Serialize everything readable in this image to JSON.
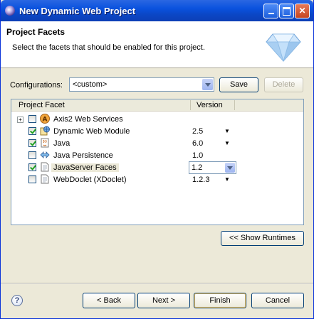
{
  "window": {
    "title": "New Dynamic Web Project"
  },
  "header": {
    "title": "Project Facets",
    "description": "Select the facets that should be enabled for this project."
  },
  "configurations": {
    "label": "Configurations:",
    "value": "<custom>",
    "save_label": "Save",
    "delete_label": "Delete"
  },
  "table": {
    "columns": [
      "Project Facet",
      "Version"
    ],
    "rows": [
      {
        "name": "Axis2 Web Services",
        "version": "",
        "checked": false,
        "expandable": true,
        "icon": "axis2-icon"
      },
      {
        "name": "Dynamic Web Module",
        "version": "2.5",
        "checked": true,
        "icon": "web-module-icon"
      },
      {
        "name": "Java",
        "version": "6.0",
        "checked": true,
        "icon": "java-icon"
      },
      {
        "name": "Java Persistence",
        "version": "1.0",
        "checked": false,
        "icon": "persistence-icon"
      },
      {
        "name": "JavaServer Faces",
        "version": "1.2",
        "checked": true,
        "selected": true,
        "icon": "document-icon"
      },
      {
        "name": "WebDoclet (XDoclet)",
        "version": "1.2.3",
        "checked": false,
        "icon": "document-icon"
      }
    ]
  },
  "show_runtimes_label": "<< Show Runtimes",
  "buttons": {
    "back": "< Back",
    "next": "Next >",
    "finish": "Finish",
    "cancel": "Cancel"
  },
  "colors": {
    "titlebar": "#0a52de",
    "checkmark": "#21a121",
    "background": "#ece9d8"
  }
}
